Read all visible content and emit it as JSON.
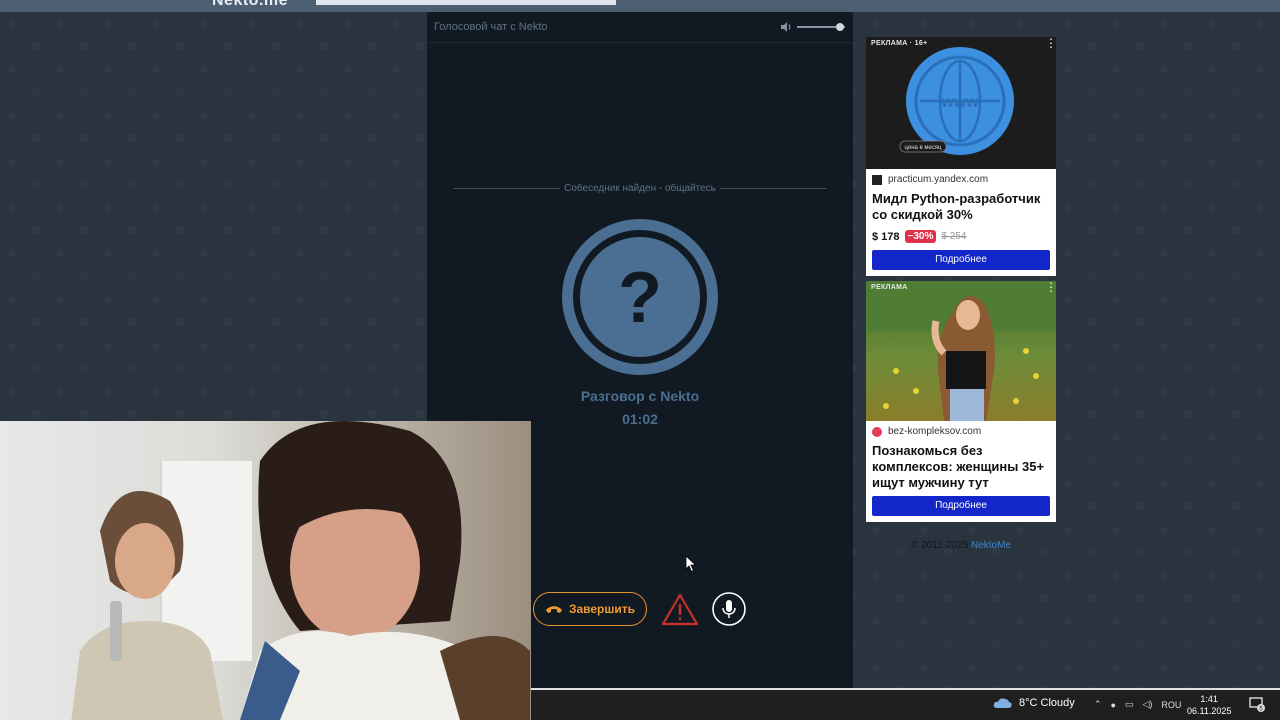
{
  "topbar": {
    "brand": "Nekto.me"
  },
  "chat": {
    "title": "Голосовой чат с Nekto",
    "status": "Собеседник найден - общайтесь",
    "avatar_glyph": "?",
    "conversation_title": "Разговор с Nekto",
    "timer": "01:02",
    "volume_level": 0.9,
    "buttons": {
      "end_label": "Завершить"
    }
  },
  "ads": [
    {
      "label": "РЕКЛАМА · 16+",
      "domain": "practicum.yandex.com",
      "headline": "Мидл Python-разработчик со скидкой 30%",
      "price_now": "$ 178",
      "discount": "−30%",
      "price_old": "$ 254",
      "button": "Подробнее",
      "image_caption": "цена в месяц"
    },
    {
      "label": "РЕКЛАМА",
      "domain": "bez-kompleksov.com",
      "headline": "Познакомься без комплексов: женщины 35+ ищут мужчину тут",
      "button": "Подробнее"
    }
  ],
  "footer": {
    "copyright": "© 2011-2025",
    "link": "NektoMe"
  },
  "taskbar": {
    "weather": "8°C  Cloudy",
    "language": "ROU",
    "time": "1:41",
    "date": "06.11.2025",
    "notifications": "5"
  },
  "colors": {
    "accent_orange": "#f09a30",
    "accent_blue": "#4a6f93",
    "ad_button": "#1226c9",
    "discount_red": "#e0304a"
  }
}
